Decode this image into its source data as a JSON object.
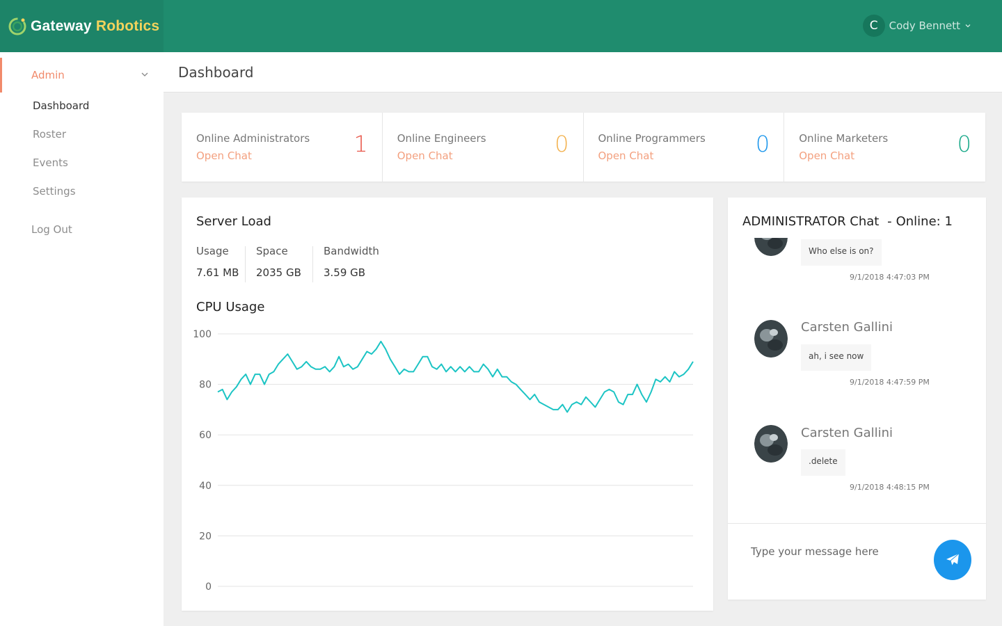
{
  "brand": {
    "name_part1": "Gateway",
    "name_part2": "Robotics",
    "logo_icon": "gear-icon"
  },
  "user": {
    "initial": "C",
    "name": "Cody Bennett",
    "caret_icon": "chevron-down-icon"
  },
  "sidebar": {
    "admin_label": "Admin",
    "items": [
      {
        "label": "Dashboard",
        "active": true
      },
      {
        "label": "Roster",
        "active": false
      },
      {
        "label": "Events",
        "active": false
      },
      {
        "label": "Settings",
        "active": false
      }
    ],
    "logout_label": "Log Out"
  },
  "page": {
    "title": "Dashboard"
  },
  "stats": [
    {
      "label": "Online Administrators",
      "link": "Open Chat",
      "count": "1",
      "color": "#e8574a"
    },
    {
      "label": "Online Engineers",
      "link": "Open Chat",
      "count": "0",
      "color": "#f3b24f"
    },
    {
      "label": "Online Programmers",
      "link": "Open Chat",
      "count": "0",
      "color": "#1b96ec"
    },
    {
      "label": "Online Marketers",
      "link": "Open Chat",
      "count": "0",
      "color": "#1aa98a"
    }
  ],
  "server_load": {
    "title": "Server Load",
    "metrics": [
      {
        "label": "Usage",
        "value": "7.61 MB"
      },
      {
        "label": "Space",
        "value": "2035 GB"
      },
      {
        "label": "Bandwidth",
        "value": "3.59 GB"
      }
    ]
  },
  "cpu": {
    "title": "CPU Usage",
    "chart_data": {
      "type": "line",
      "title": "CPU Usage",
      "xlabel": "",
      "ylabel": "",
      "ylim": [
        0,
        100
      ],
      "yticks": [
        "0",
        "20",
        "40",
        "60",
        "80",
        "100"
      ],
      "grid": true,
      "line_color": "#1cc4c4",
      "series": [
        {
          "values": [
            77,
            78,
            74,
            77,
            79,
            82,
            84,
            80,
            84,
            84,
            80,
            84,
            85,
            88,
            90,
            92,
            89,
            86,
            87,
            89,
            87,
            86,
            86,
            87,
            85,
            87,
            91,
            87,
            88,
            86,
            87,
            90,
            93,
            92,
            94,
            97,
            94,
            90,
            87,
            84,
            86,
            85,
            85,
            88,
            91,
            91,
            87,
            86,
            88,
            85,
            87,
            85,
            87,
            85,
            87,
            85,
            85,
            88,
            86,
            83,
            86,
            83,
            83,
            81,
            80,
            78,
            76,
            74,
            76,
            73,
            72,
            71,
            70,
            70,
            72,
            69,
            72,
            73,
            72,
            75,
            73,
            71,
            74,
            77,
            78,
            77,
            73,
            72,
            76,
            76,
            80,
            76,
            73,
            77,
            82,
            81,
            83,
            81,
            85,
            83,
            84,
            86,
            89
          ]
        }
      ]
    }
  },
  "chat": {
    "title": "ADMINISTRATOR Chat",
    "sep": "-",
    "online": "Online: 1",
    "messages": [
      {
        "author": "",
        "text": "Who else is on?",
        "time": "9/1/2018 4:47:03 PM"
      },
      {
        "author": "Carsten Gallini",
        "text": "ah, i see now",
        "time": "9/1/2018 4:47:59 PM"
      },
      {
        "author": "Carsten Gallini",
        "text": ".delete",
        "time": "9/1/2018 4:48:15 PM"
      }
    ],
    "input_placeholder": "Type your message here",
    "send_icon": "paper-plane-icon",
    "send_color": "#1b96ec"
  }
}
